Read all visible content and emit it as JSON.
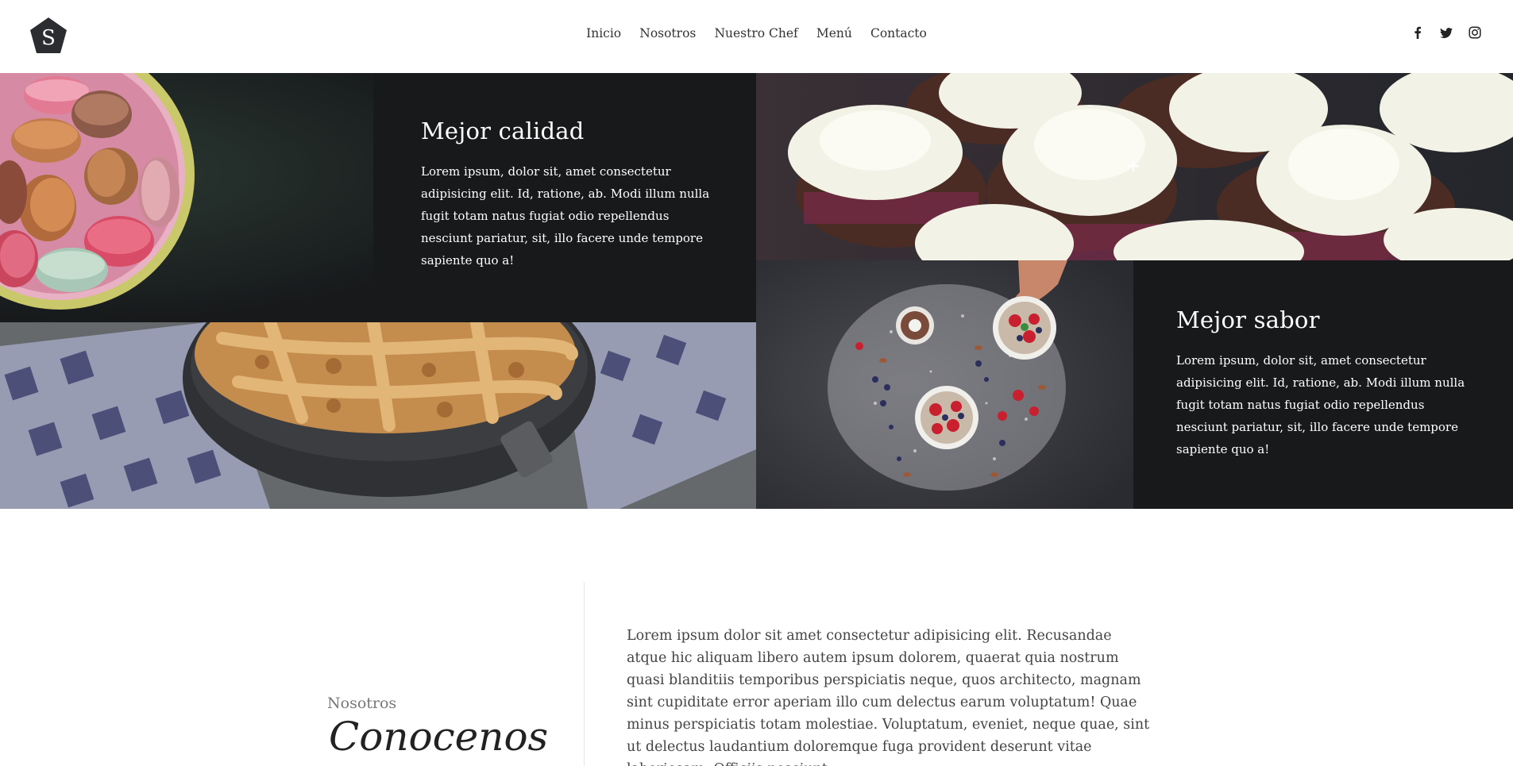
{
  "brand": {
    "logo_letter": "S"
  },
  "nav": {
    "items": [
      "Inicio",
      "Nosotros",
      "Nuestro Chef",
      "Menú",
      "Contacto"
    ]
  },
  "social": {
    "icons": [
      "facebook-icon",
      "twitter-icon",
      "instagram-icon"
    ]
  },
  "features": [
    {
      "title": "Mejor calidad",
      "text": "Lorem ipsum, dolor sit, amet consectetur adipisicing elit. Id, ratione, ab. Modi illum nulla fugit totam natus fugiat odio repellendus nesciunt pariatur, sit, illo facere unde tempore sapiente quo a!"
    },
    {
      "title": "Mejor sabor",
      "text": "Lorem ipsum, dolor sit, amet consectetur adipisicing elit. Id, ratione, ab. Modi illum nulla fugit totam natus fugiat odio repellendus nesciunt pariatur, sit, illo facere unde tempore sapiente quo a!"
    }
  ],
  "about": {
    "kicker": "Nosotros",
    "title": "Conocenos",
    "body": "Lorem ipsum dolor sit amet consectetur adipisicing elit. Recusandae atque hic aliquam libero autem ipsum dolorem, quaerat quia nostrum quasi blanditiis temporibus perspiciatis neque, quos architecto, magnam sint cupiditate error aperiam illo cum delectus earum voluptatum! Quae minus perspiciatis totam molestiae. Voluptatum, eveniet, neque quae, sint ut delectus laudantium doloremque fuga provident deserunt vitae laboriosam. Officiis nesciunt"
  },
  "colors": {
    "dark_panel": "#17191b",
    "logo_fill": "#2b2d30"
  }
}
